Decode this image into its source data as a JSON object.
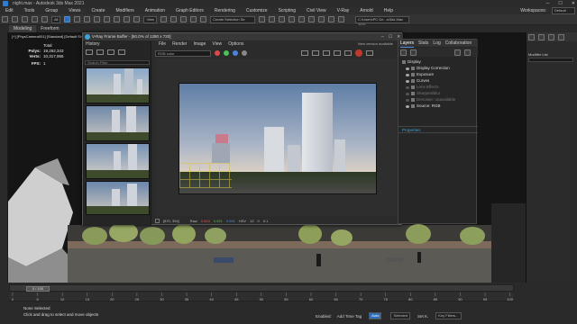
{
  "window": {
    "title": "night.max - Autodesk 3ds Max 2021"
  },
  "menu": [
    "Edit",
    "Tools",
    "Group",
    "Views",
    "Create",
    "Modifiers",
    "Animation",
    "Graph Editors",
    "Rendering",
    "Customize",
    "Scripting",
    "Civil View",
    "V-Ray",
    "Arnold",
    "Help"
  ],
  "workspaces": {
    "label": "Workspaces:",
    "value": "Default"
  },
  "toolbar": {
    "view_select": "View",
    "selection_set": "Create Selection Se",
    "path": "C:\\Users\\PC De...s\\3ds Max 2021"
  },
  "ribbon": {
    "tabs": [
      "Modeling",
      "Freeform"
    ]
  },
  "viewport": {
    "label": "[+] [PhysCamera001] [Standard] [Default Shading]",
    "stats": {
      "header": "Total",
      "polys_label": "Polys:",
      "polys": "19,262,343",
      "verts_label": "Verts:",
      "verts": "10,317,955",
      "fps_label": "FPS:",
      "fps": "1"
    }
  },
  "vfb": {
    "title": "V-Ray Frame Buffer - [50.0% of 1280 x 720]",
    "menu": [
      "File",
      "Render",
      "Image",
      "View",
      "Options"
    ],
    "history_title": "History",
    "search_placeholder": "Search Filter",
    "channel_select": "RGB color",
    "new_version": "New version available",
    "status_coords": "[870, 394]",
    "status_mode": "Raw",
    "status_values": [
      "0.663",
      "0.991",
      "0.091"
    ],
    "status_hsv": "HSV",
    "status_nums": [
      "12",
      "0",
      "0.1"
    ]
  },
  "layers": {
    "tabs": [
      "Layers",
      "Stats",
      "Log",
      "Collaboration"
    ],
    "items": [
      {
        "name": "Display",
        "dim": false
      },
      {
        "name": "Display Correction",
        "dim": false
      },
      {
        "name": "Exposure",
        "dim": false
      },
      {
        "name": "Curves",
        "dim": false
      },
      {
        "name": "Lens Effects",
        "dim": true
      },
      {
        "name": "Sharpen/Blur",
        "dim": true
      },
      {
        "name": "Denoiser: unavailable",
        "dim": true
      },
      {
        "name": "Source: RGB",
        "dim": false
      }
    ],
    "properties_title": "Properties"
  },
  "rightpanel": {
    "modifier_list": "Modifier List"
  },
  "timeline": {
    "position": "0 / 100",
    "frames": [
      "0",
      "5",
      "10",
      "15",
      "20",
      "25",
      "30",
      "35",
      "40",
      "45",
      "50",
      "55",
      "60",
      "65",
      "70",
      "75",
      "80",
      "85",
      "90",
      "95",
      "100"
    ]
  },
  "status": {
    "selected": "None Selected",
    "hint": "Click and drag to select and move objects",
    "enabled": "Enabled:",
    "add_time_tag": "Add Time Tag",
    "auto": "Auto",
    "selected_dropdown": "Selected",
    "set_key": "Set K.",
    "key_filters": "Key Filters..."
  },
  "colors": {
    "accent": "#2d6fb8",
    "vray_blue": "#3fa3d8"
  }
}
